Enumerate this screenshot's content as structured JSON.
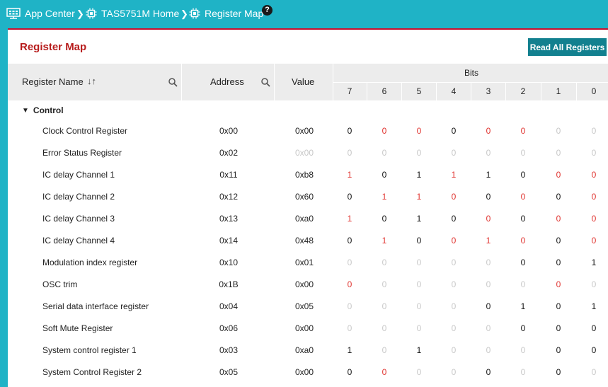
{
  "breadcrumb": [
    {
      "label": "App Center",
      "icon": "app-center-icon"
    },
    {
      "label": "TAS5751M Home",
      "icon": "chip-icon"
    },
    {
      "label": "Register Map",
      "icon": "chip-icon"
    }
  ],
  "help_label": "?",
  "panel": {
    "title": "Register Map",
    "read_all_label": "Read All Registers"
  },
  "table": {
    "columns": {
      "name": "Register Name",
      "address": "Address",
      "value": "Value",
      "bits": "Bits"
    },
    "bit_headers": [
      "7",
      "6",
      "5",
      "4",
      "3",
      "2",
      "1",
      "0"
    ],
    "group": "Control",
    "rows": [
      {
        "name": "Clock Control Register",
        "address": "0x00",
        "value": "0x00",
        "value_dim": false,
        "bits": [
          [
            "0",
            "black"
          ],
          [
            "0",
            "red"
          ],
          [
            "0",
            "red"
          ],
          [
            "0",
            "black"
          ],
          [
            "0",
            "red"
          ],
          [
            "0",
            "red"
          ],
          [
            "0",
            "gray"
          ],
          [
            "0",
            "gray"
          ]
        ]
      },
      {
        "name": "Error Status Register",
        "address": "0x02",
        "value": "0x00",
        "value_dim": true,
        "bits": [
          [
            "0",
            "gray"
          ],
          [
            "0",
            "gray"
          ],
          [
            "0",
            "gray"
          ],
          [
            "0",
            "gray"
          ],
          [
            "0",
            "gray"
          ],
          [
            "0",
            "gray"
          ],
          [
            "0",
            "gray"
          ],
          [
            "0",
            "gray"
          ]
        ]
      },
      {
        "name": "IC delay Channel 1",
        "address": "0x11",
        "value": "0xb8",
        "value_dim": false,
        "bits": [
          [
            "1",
            "red"
          ],
          [
            "0",
            "black"
          ],
          [
            "1",
            "black"
          ],
          [
            "1",
            "red"
          ],
          [
            "1",
            "black"
          ],
          [
            "0",
            "black"
          ],
          [
            "0",
            "red"
          ],
          [
            "0",
            "red"
          ]
        ]
      },
      {
        "name": "IC delay Channel 2",
        "address": "0x12",
        "value": "0x60",
        "value_dim": false,
        "bits": [
          [
            "0",
            "black"
          ],
          [
            "1",
            "red"
          ],
          [
            "1",
            "red"
          ],
          [
            "0",
            "red"
          ],
          [
            "0",
            "black"
          ],
          [
            "0",
            "red"
          ],
          [
            "0",
            "black"
          ],
          [
            "0",
            "red"
          ]
        ]
      },
      {
        "name": "IC delay Channel 3",
        "address": "0x13",
        "value": "0xa0",
        "value_dim": false,
        "bits": [
          [
            "1",
            "red"
          ],
          [
            "0",
            "black"
          ],
          [
            "1",
            "black"
          ],
          [
            "0",
            "black"
          ],
          [
            "0",
            "red"
          ],
          [
            "0",
            "black"
          ],
          [
            "0",
            "red"
          ],
          [
            "0",
            "red"
          ]
        ]
      },
      {
        "name": "IC delay Channel 4",
        "address": "0x14",
        "value": "0x48",
        "value_dim": false,
        "bits": [
          [
            "0",
            "black"
          ],
          [
            "1",
            "red"
          ],
          [
            "0",
            "black"
          ],
          [
            "0",
            "red"
          ],
          [
            "1",
            "red"
          ],
          [
            "0",
            "red"
          ],
          [
            "0",
            "black"
          ],
          [
            "0",
            "red"
          ]
        ]
      },
      {
        "name": "Modulation index register",
        "address": "0x10",
        "value": "0x01",
        "value_dim": false,
        "bits": [
          [
            "0",
            "gray"
          ],
          [
            "0",
            "gray"
          ],
          [
            "0",
            "gray"
          ],
          [
            "0",
            "gray"
          ],
          [
            "0",
            "gray"
          ],
          [
            "0",
            "black"
          ],
          [
            "0",
            "black"
          ],
          [
            "1",
            "black"
          ]
        ]
      },
      {
        "name": "OSC trim",
        "address": "0x1B",
        "value": "0x00",
        "value_dim": false,
        "bits": [
          [
            "0",
            "red"
          ],
          [
            "0",
            "gray"
          ],
          [
            "0",
            "gray"
          ],
          [
            "0",
            "gray"
          ],
          [
            "0",
            "gray"
          ],
          [
            "0",
            "gray"
          ],
          [
            "0",
            "red"
          ],
          [
            "0",
            "gray"
          ]
        ]
      },
      {
        "name": "Serial data interface register",
        "address": "0x04",
        "value": "0x05",
        "value_dim": false,
        "bits": [
          [
            "0",
            "gray"
          ],
          [
            "0",
            "gray"
          ],
          [
            "0",
            "gray"
          ],
          [
            "0",
            "gray"
          ],
          [
            "0",
            "black"
          ],
          [
            "1",
            "black"
          ],
          [
            "0",
            "black"
          ],
          [
            "1",
            "black"
          ]
        ]
      },
      {
        "name": "Soft Mute Register",
        "address": "0x06",
        "value": "0x00",
        "value_dim": false,
        "bits": [
          [
            "0",
            "gray"
          ],
          [
            "0",
            "gray"
          ],
          [
            "0",
            "gray"
          ],
          [
            "0",
            "gray"
          ],
          [
            "0",
            "gray"
          ],
          [
            "0",
            "black"
          ],
          [
            "0",
            "black"
          ],
          [
            "0",
            "black"
          ]
        ]
      },
      {
        "name": "System control register 1",
        "address": "0x03",
        "value": "0xa0",
        "value_dim": false,
        "bits": [
          [
            "1",
            "black"
          ],
          [
            "0",
            "gray"
          ],
          [
            "1",
            "black"
          ],
          [
            "0",
            "gray"
          ],
          [
            "0",
            "gray"
          ],
          [
            "0",
            "gray"
          ],
          [
            "0",
            "black"
          ],
          [
            "0",
            "black"
          ]
        ]
      },
      {
        "name": "System Control Register 2",
        "address": "0x05",
        "value": "0x00",
        "value_dim": false,
        "bits": [
          [
            "0",
            "black"
          ],
          [
            "0",
            "red"
          ],
          [
            "0",
            "gray"
          ],
          [
            "0",
            "gray"
          ],
          [
            "0",
            "black"
          ],
          [
            "0",
            "gray"
          ],
          [
            "0",
            "black"
          ],
          [
            "0",
            "gray"
          ]
        ]
      }
    ]
  },
  "colors": {
    "header_bg": "#1fb3c6",
    "title_red": "#b71c1c",
    "button_teal": "#12808f",
    "bit_red": "#e0332f",
    "bit_gray": "#c8c8c8"
  }
}
